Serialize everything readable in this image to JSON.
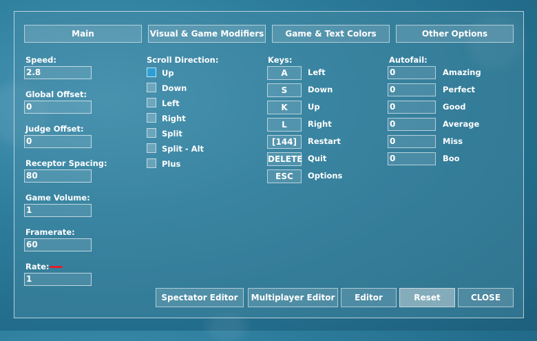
{
  "tabs": [
    "Main",
    "Visual & Game Modifiers",
    "Game & Text Colors",
    "Other Options"
  ],
  "settings": [
    {
      "label": "Speed:",
      "value": "2.8"
    },
    {
      "label": "Global Offset:",
      "value": "0"
    },
    {
      "label": "Judge Offset:",
      "value": "0"
    },
    {
      "label": "Receptor Spacing:",
      "value": "80"
    },
    {
      "label": "Game Volume:",
      "value": "1"
    },
    {
      "label": "Framerate:",
      "value": "60"
    },
    {
      "label": "Rate:",
      "value": "1"
    }
  ],
  "scroll": {
    "title": "Scroll Direction:",
    "options": [
      "Up",
      "Down",
      "Left",
      "Right",
      "Split",
      "Split - Alt",
      "Plus"
    ],
    "selected": "Up",
    "checked_color": "#2d9fd6"
  },
  "keys": {
    "title": "Keys:",
    "items": [
      {
        "key": "A",
        "action": "Left"
      },
      {
        "key": "S",
        "action": "Down"
      },
      {
        "key": "K",
        "action": "Up"
      },
      {
        "key": "L",
        "action": "Right"
      },
      {
        "key": "[144]",
        "action": "Restart"
      },
      {
        "key": "DELETE",
        "action": "Quit"
      },
      {
        "key": "ESC",
        "action": "Options"
      }
    ]
  },
  "autofail": {
    "title": "Autofail:",
    "items": [
      {
        "value": "0",
        "judge": "Amazing"
      },
      {
        "value": "0",
        "judge": "Perfect"
      },
      {
        "value": "0",
        "judge": "Good"
      },
      {
        "value": "0",
        "judge": "Average"
      },
      {
        "value": "0",
        "judge": "Miss"
      },
      {
        "value": "0",
        "judge": "Boo"
      }
    ]
  },
  "buttons": {
    "spectator": "Spectator Editor",
    "multiplayer": "Multiplayer Editor",
    "editor": "Editor",
    "reset": "Reset",
    "close": "CLOSE"
  }
}
